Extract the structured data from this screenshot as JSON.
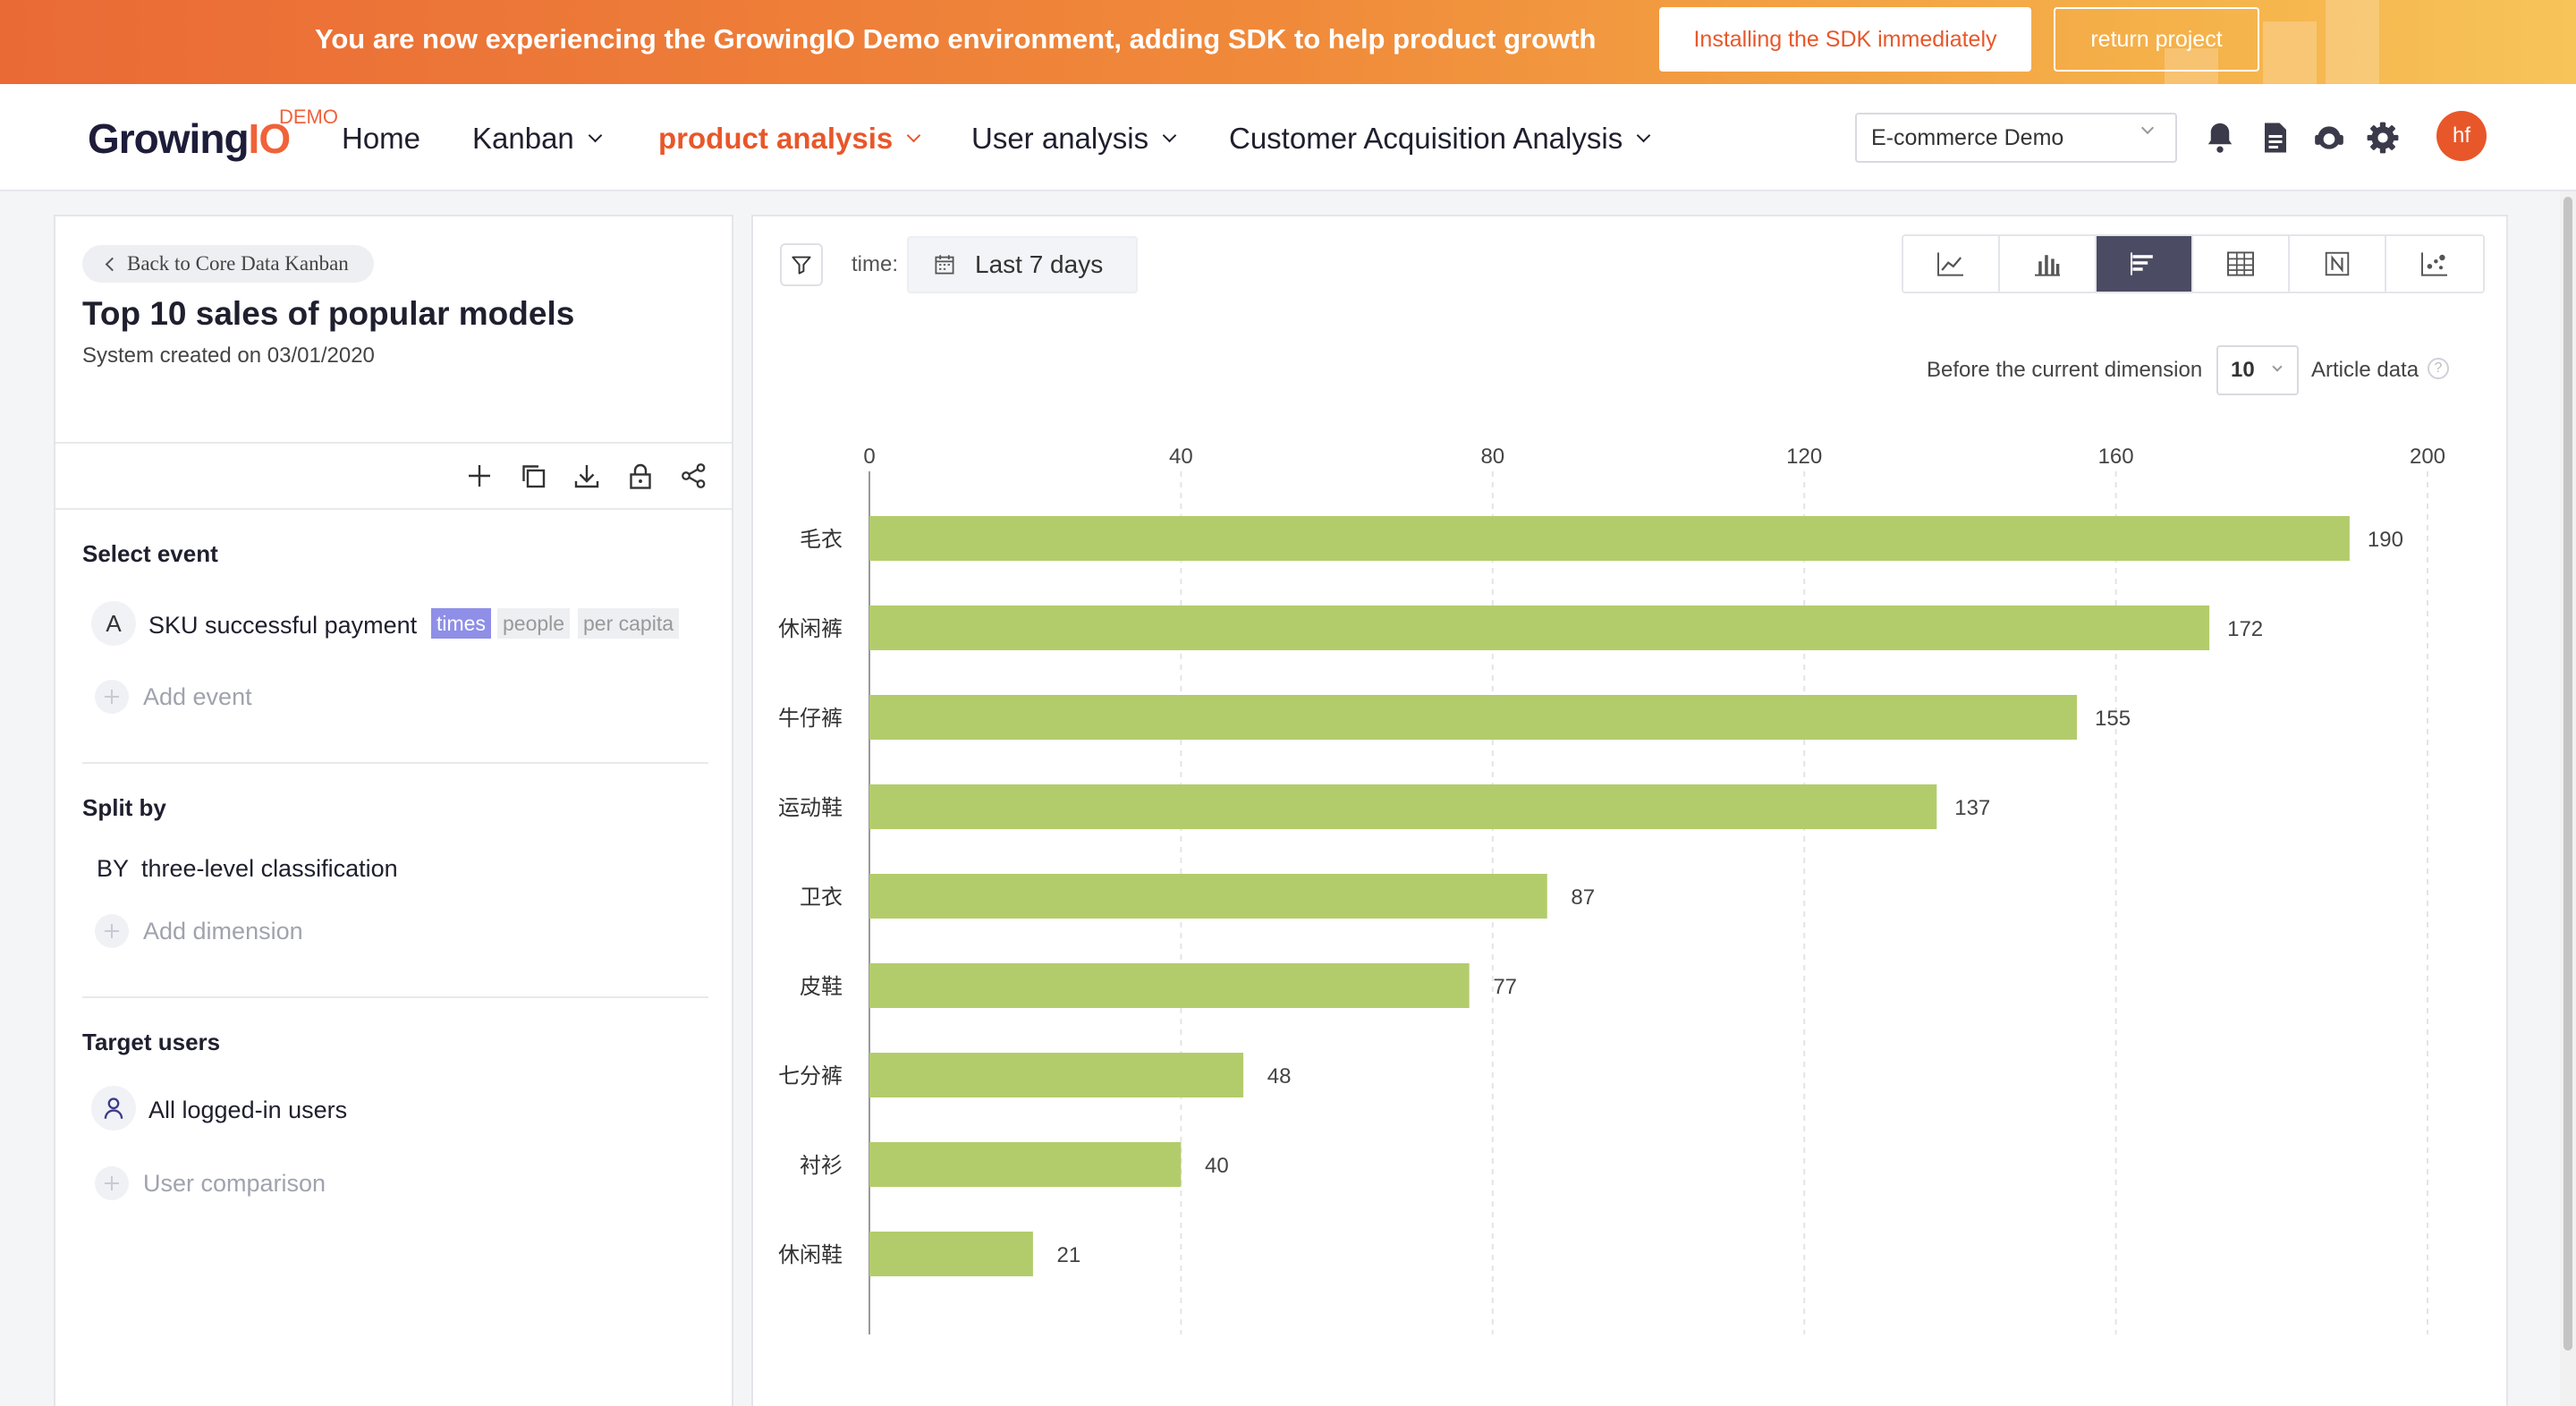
{
  "banner": {
    "message": "You are now experiencing the GrowingIO Demo environment, adding SDK to help product growth",
    "install_button": "Installing the SDK immediately",
    "return_button": "return project"
  },
  "nav": {
    "logo_text": "Growing",
    "logo_accent": "IO",
    "logo_badge": "DEMO",
    "items": [
      {
        "label": "Home",
        "dropdown": false,
        "active": false
      },
      {
        "label": "Kanban",
        "dropdown": true,
        "active": false
      },
      {
        "label": "product analysis",
        "dropdown": true,
        "active": true
      },
      {
        "label": "User analysis",
        "dropdown": true,
        "active": false
      },
      {
        "label": "Customer Acquisition Analysis",
        "dropdown": true,
        "active": false
      }
    ],
    "project_select": "E-commerce Demo",
    "icons": [
      "bell-icon",
      "document-icon",
      "support-icon",
      "gear-icon"
    ],
    "avatar_initials": "hf"
  },
  "left_panel": {
    "back_label": "Back to Core Data Kanban",
    "title": "Top 10 sales of popular models",
    "subtitle": "System created on 03/01/2020",
    "toolbar_icons": [
      "plus-icon",
      "copy-icon",
      "download-icon",
      "lock-icon",
      "share-icon"
    ],
    "select_event": {
      "heading": "Select event",
      "event_letter": "A",
      "event_name": "SKU successful payment",
      "metrics": [
        "times",
        "people",
        "per capita"
      ],
      "active_metric": "times",
      "add_label": "Add event"
    },
    "split_by": {
      "heading": "Split by",
      "prefix": "BY",
      "dimension": "three-level classification",
      "add_label": "Add dimension"
    },
    "target_users": {
      "heading": "Target users",
      "users": "All logged-in users",
      "add_label": "User comparison"
    }
  },
  "right_panel": {
    "time_label": "time:",
    "time_value": "Last 7 days",
    "chart_types": [
      "line-chart-icon",
      "bar-chart-icon",
      "horizontal-bar-icon",
      "table-icon",
      "number-icon",
      "scatter-icon"
    ],
    "active_chart_type": "horizontal-bar-icon",
    "top_prefix": "Before the current dimension",
    "top_value": "10",
    "top_suffix": "Article data"
  },
  "colors": {
    "accent": "#e8572a",
    "bar": "#b3cc6b",
    "active_switch": "#4b4b63",
    "metric_active": "#8f8fe8"
  },
  "chart_data": {
    "type": "bar",
    "orientation": "horizontal",
    "categories": [
      "毛衣",
      "休闲裤",
      "牛仔裤",
      "运动鞋",
      "卫衣",
      "皮鞋",
      "七分裤",
      "衬衫",
      "休闲鞋"
    ],
    "values": [
      190,
      172,
      155,
      137,
      87,
      77,
      48,
      40,
      21
    ],
    "xlim": [
      0,
      200
    ],
    "ticks": [
      0,
      40,
      80,
      120,
      160,
      200
    ],
    "grid": true,
    "data_labels": true
  }
}
